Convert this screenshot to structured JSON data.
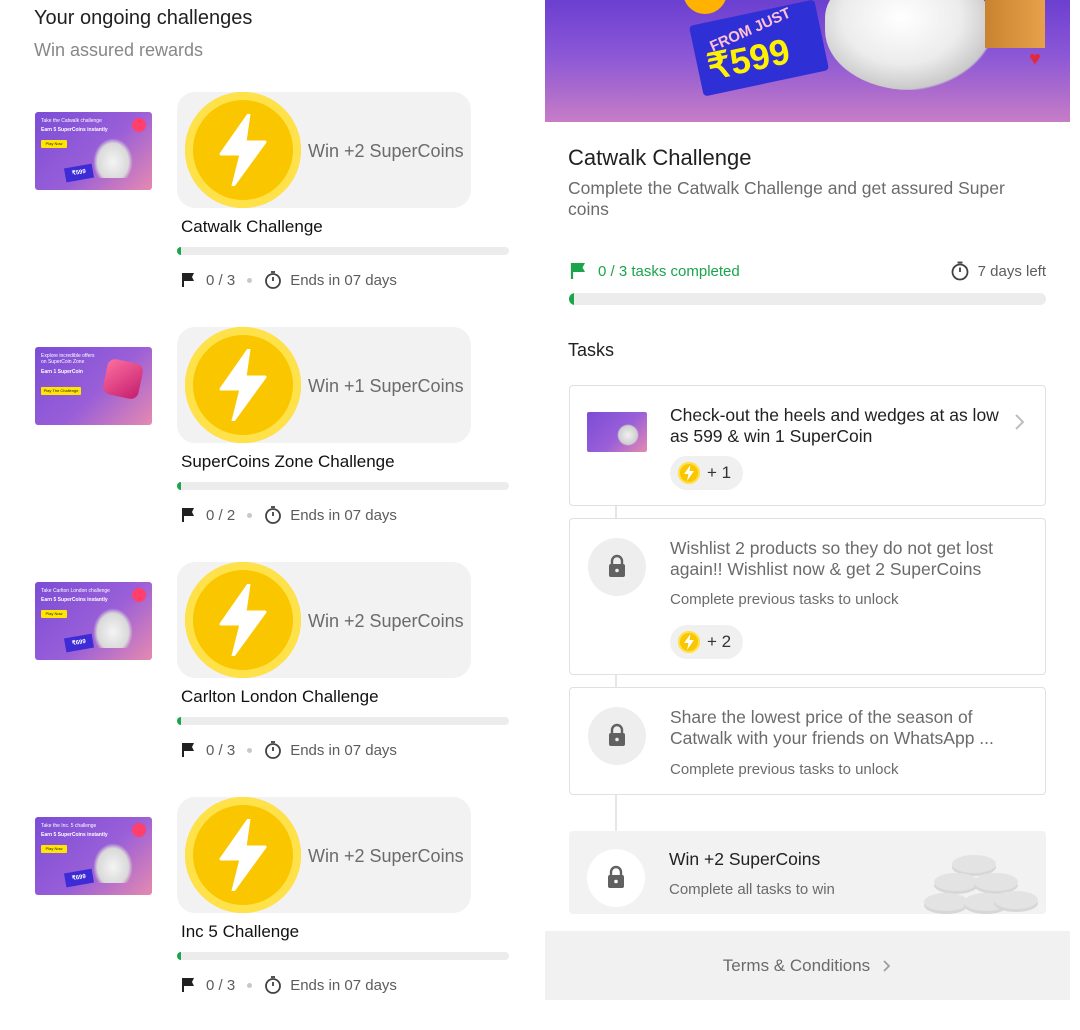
{
  "left": {
    "title": "Your ongoing challenges",
    "subtitle": "Win assured rewards",
    "challenges": [
      {
        "thumb_line1": "Take the Catwalk challenge",
        "thumb_line2": "Earn 5 SuperCoins instantly",
        "thumb_button": "Play Now",
        "thumb_price": "₹599",
        "win": "Win +2 SuperCoins",
        "name": "Catwalk Challenge",
        "progress": "0 / 3",
        "progress_fraction": 0.0,
        "ends": "Ends in 07 days"
      },
      {
        "thumb_line1": "Explore incredible offers on SuperCoin Zone",
        "thumb_line2": "Earn 1 SuperCoin",
        "thumb_button": "Play The Challenge",
        "thumb_price": "",
        "win": "Win +1 SuperCoins",
        "name": "SuperCoins Zone Challenge",
        "progress": "0 / 2",
        "progress_fraction": 0.0,
        "ends": "Ends in 07 days"
      },
      {
        "thumb_line1": "Take Carlton London challenge",
        "thumb_line2": "Earn 5 SuperCoins instantly",
        "thumb_button": "Play Now",
        "thumb_price": "₹699",
        "win": "Win +2 SuperCoins",
        "name": "Carlton London Challenge",
        "progress": "0 / 3",
        "progress_fraction": 0.0,
        "ends": "Ends in 07 days"
      },
      {
        "thumb_line1": "Take the Inc. 5 challenge",
        "thumb_line2": "Earn 5 SuperCoins instantly",
        "thumb_button": "Play Now",
        "thumb_price": "₹699",
        "win": "Win +2 SuperCoins",
        "name": "Inc 5 Challenge",
        "progress": "0 / 3",
        "progress_fraction": 0.0,
        "ends": "Ends in 07 days"
      }
    ]
  },
  "right": {
    "banner": {
      "from_text": "FROM JUST",
      "price": "₹599"
    },
    "title": "Catwalk Challenge",
    "description": "Complete the Catwalk Challenge and get assured Super coins",
    "tasks_completed": "0 / 3 tasks completed",
    "progress_fraction": 0.0,
    "days_left": "7 days left",
    "tasks_heading": "Tasks",
    "tasks": [
      {
        "title": "Check-out the heels and wedges at as low as 599 & win 1 SuperCoin",
        "subtitle": "",
        "reward": "+ 1",
        "locked": false
      },
      {
        "title": "Wishlist 2 products so they do not get lost again!! Wishlist now & get 2 SuperCoins",
        "subtitle": "Complete previous tasks to unlock",
        "reward": "+ 2",
        "locked": true
      },
      {
        "title": "Share the lowest price of the season of Catwalk with your friends on WhatsApp ...",
        "subtitle": "Complete previous tasks to unlock",
        "reward": "",
        "locked": true
      }
    ],
    "final": {
      "title": "Win +2 SuperCoins",
      "subtitle": "Complete all tasks to win"
    },
    "terms": "Terms & Conditions"
  },
  "colors": {
    "accent_green": "#1aa54b",
    "coin_yellow": "#f9c600",
    "banner_purple": "#6b3fd0"
  },
  "icons": [
    "flag-icon",
    "timer-icon",
    "lightning-icon",
    "lock-icon",
    "chevron-right-icon",
    "heart-icon"
  ]
}
